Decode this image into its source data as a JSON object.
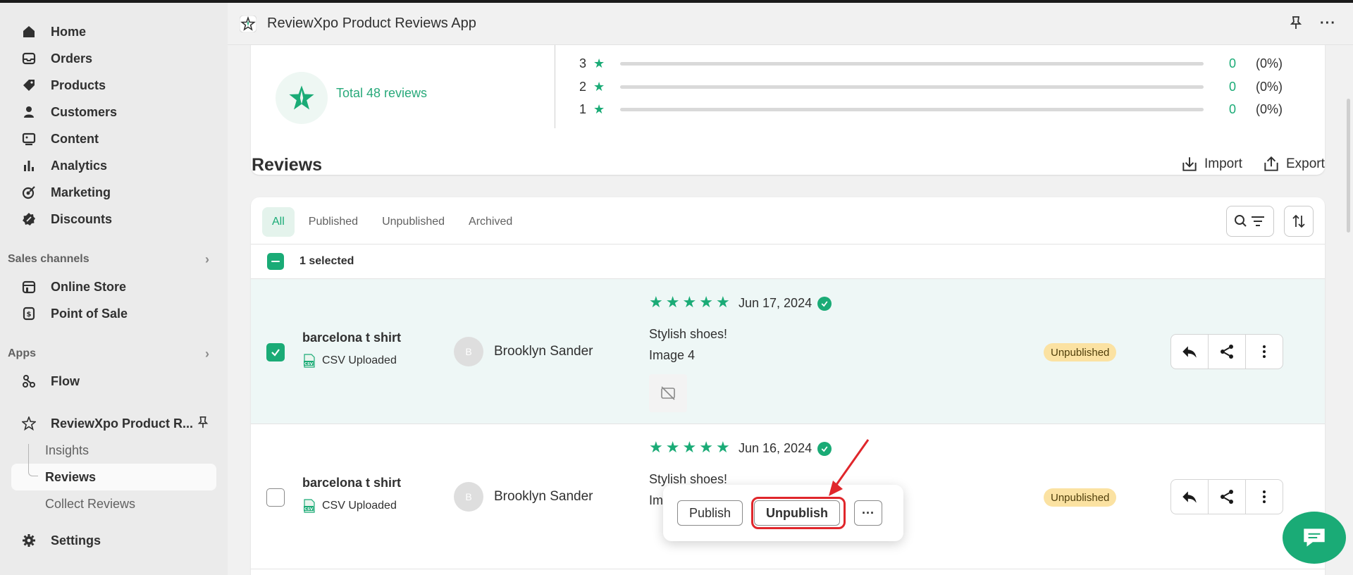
{
  "sidebar": {
    "nav": [
      {
        "label": "Home",
        "icon": "home-icon"
      },
      {
        "label": "Orders",
        "icon": "inbox-icon"
      },
      {
        "label": "Products",
        "icon": "tag-icon"
      },
      {
        "label": "Customers",
        "icon": "person-icon"
      },
      {
        "label": "Content",
        "icon": "image-icon"
      },
      {
        "label": "Analytics",
        "icon": "bar-chart-icon"
      },
      {
        "label": "Marketing",
        "icon": "target-icon"
      },
      {
        "label": "Discounts",
        "icon": "discount-icon"
      }
    ],
    "sales_channels_label": "Sales channels",
    "channels": [
      {
        "label": "Online Store"
      },
      {
        "label": "Point of Sale"
      }
    ],
    "apps_label": "Apps",
    "apps": [
      {
        "label": "Flow"
      }
    ],
    "current_app": "ReviewXpo Product R...",
    "app_sub": [
      "Insights",
      "Reviews",
      "Collect Reviews"
    ],
    "settings_label": "Settings"
  },
  "header": {
    "title": "ReviewXpo Product Reviews App",
    "more": "···"
  },
  "summary": {
    "total": "Total 48 reviews",
    "rows": [
      {
        "stars": "3",
        "count": "0",
        "pct": "(0%)"
      },
      {
        "stars": "2",
        "count": "0",
        "pct": "(0%)"
      },
      {
        "stars": "1",
        "count": "0",
        "pct": "(0%)"
      }
    ]
  },
  "reviews_section": {
    "title": "Reviews",
    "import": "Import",
    "export": "Export",
    "tabs": [
      "All",
      "Published",
      "Unpublished",
      "Archived"
    ],
    "selected_text": "1 selected"
  },
  "rows": [
    {
      "product": "barcelona t shirt",
      "source": "CSV Uploaded",
      "avatar": "B",
      "author": "Brooklyn Sander",
      "rating": 5,
      "date": "Jun 17, 2024",
      "title": "Stylish shoes!",
      "body": "Image 4",
      "status": "Unpublished",
      "checked": true
    },
    {
      "product": "barcelona t shirt",
      "source": "CSV Uploaded",
      "avatar": "B",
      "author": "Brooklyn Sander",
      "rating": 5,
      "date": "Jun 16, 2024",
      "title": "Stylish shoes!",
      "body": "Im",
      "status": "Unpublished",
      "checked": false
    }
  ],
  "popover": {
    "publish": "Publish",
    "unpublish": "Unpublish",
    "more": "···"
  },
  "colors": {
    "accent": "#1aab76",
    "highlight": "#e0262b",
    "status_unpublished": "#fbe2a2"
  }
}
